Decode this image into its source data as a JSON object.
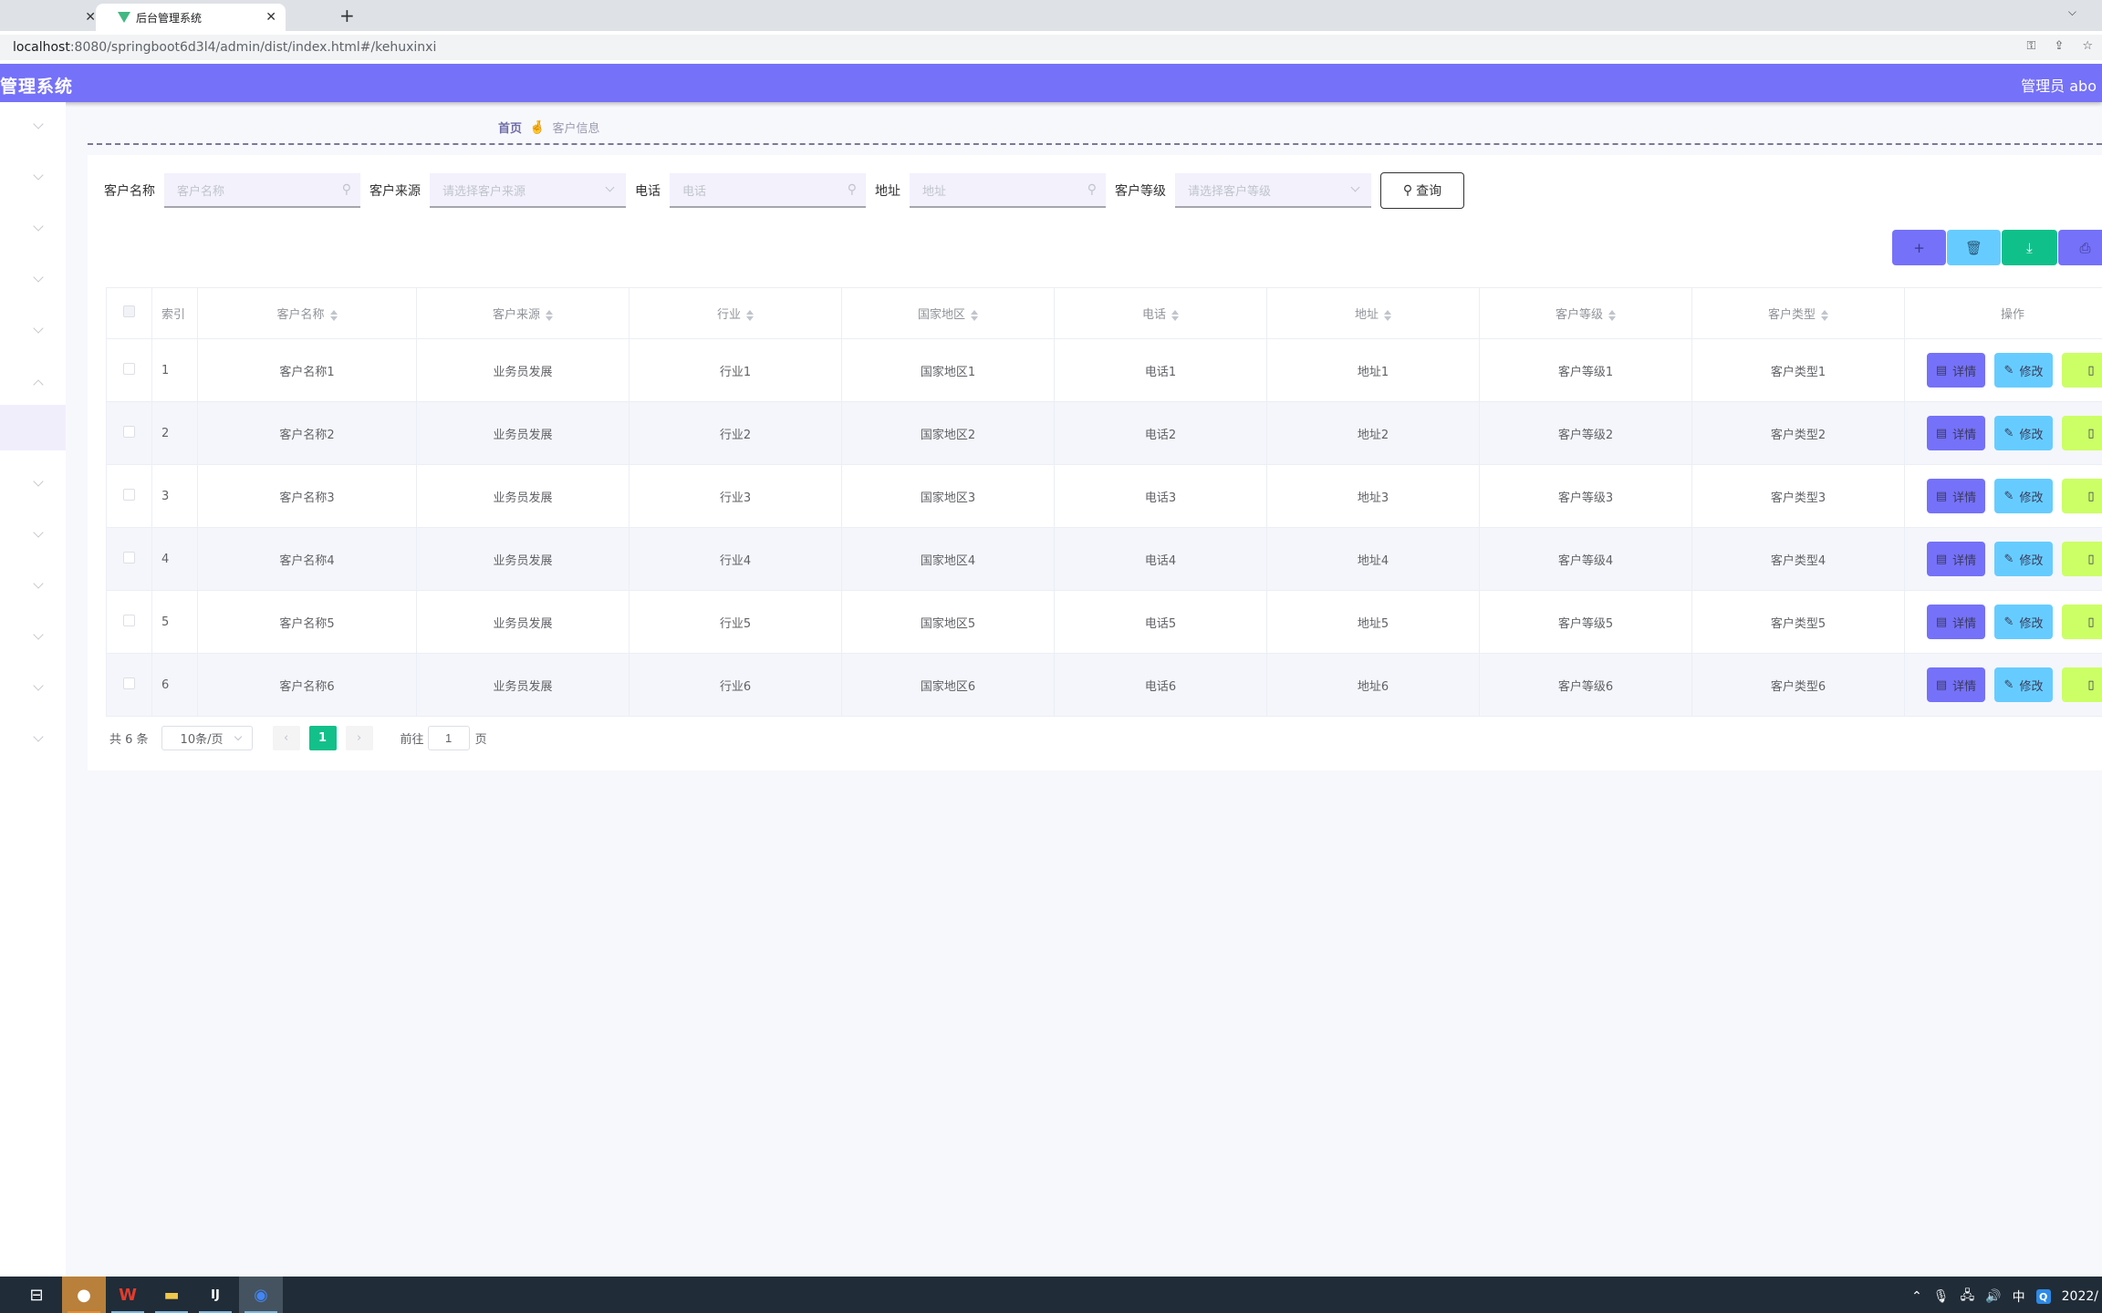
{
  "browser": {
    "tabs": [
      {
        "title": "",
        "active": false
      },
      {
        "title": "后台管理系统",
        "active": true
      }
    ],
    "new_tab_label": "+",
    "tab_close_label": "✕",
    "url_host": "localhost",
    "url_rest": ":8080/springboot6d3l4/admin/dist/index.html#/kehuxinxi"
  },
  "header": {
    "title": "管理系统",
    "user": "管理员 abo"
  },
  "sidebar": {
    "items": [
      {
        "expanded": false
      },
      {
        "expanded": false
      },
      {
        "expanded": false
      },
      {
        "expanded": false
      },
      {
        "expanded": false
      },
      {
        "expanded": true
      },
      {
        "active": true
      },
      {
        "expanded": false
      },
      {
        "expanded": false
      },
      {
        "expanded": false
      },
      {
        "expanded": false
      },
      {
        "expanded": false
      },
      {
        "expanded": false
      }
    ]
  },
  "breadcrumb": {
    "home": "首页",
    "separator": "🤞",
    "current": "客户信息"
  },
  "search": {
    "fields": [
      {
        "label": "客户名称",
        "placeholder": "客户名称",
        "type": "input",
        "icon": "search-icon"
      },
      {
        "label": "客户来源",
        "placeholder": "请选择客户来源",
        "type": "select",
        "icon": "chevron-down-icon"
      },
      {
        "label": "电话",
        "placeholder": "电话",
        "type": "input",
        "icon": "search-icon"
      },
      {
        "label": "地址",
        "placeholder": "地址",
        "type": "input",
        "icon": "search-icon"
      },
      {
        "label": "客户等级",
        "placeholder": "请选择客户等级",
        "type": "select",
        "icon": "chevron-down-icon"
      }
    ],
    "query_label": "查询"
  },
  "toolbar": {
    "add_icon": "+",
    "delete_icon": "🗑",
    "export_icon": "⤓",
    "print_icon": "⎙"
  },
  "table": {
    "columns": [
      "索引",
      "客户名称",
      "客户来源",
      "行业",
      "国家地区",
      "电话",
      "地址",
      "客户等级",
      "客户类型",
      "操作"
    ],
    "rows": [
      {
        "index": "1",
        "name": "客户名称1",
        "source": "业务员发展",
        "industry": "行业1",
        "region": "国家地区1",
        "phone": "电话1",
        "address": "地址1",
        "level": "客户等级1",
        "type": "客户类型1"
      },
      {
        "index": "2",
        "name": "客户名称2",
        "source": "业务员发展",
        "industry": "行业2",
        "region": "国家地区2",
        "phone": "电话2",
        "address": "地址2",
        "level": "客户等级2",
        "type": "客户类型2"
      },
      {
        "index": "3",
        "name": "客户名称3",
        "source": "业务员发展",
        "industry": "行业3",
        "region": "国家地区3",
        "phone": "电话3",
        "address": "地址3",
        "level": "客户等级3",
        "type": "客户类型3"
      },
      {
        "index": "4",
        "name": "客户名称4",
        "source": "业务员发展",
        "industry": "行业4",
        "region": "国家地区4",
        "phone": "电话4",
        "address": "地址4",
        "level": "客户等级4",
        "type": "客户类型4"
      },
      {
        "index": "5",
        "name": "客户名称5",
        "source": "业务员发展",
        "industry": "行业5",
        "region": "国家地区5",
        "phone": "电话5",
        "address": "地址5",
        "level": "客户等级5",
        "type": "客户类型5"
      },
      {
        "index": "6",
        "name": "客户名称6",
        "source": "业务员发展",
        "industry": "行业6",
        "region": "国家地区6",
        "phone": "电话6",
        "address": "地址6",
        "level": "客户等级6",
        "type": "客户类型6"
      }
    ],
    "actions": {
      "detail": "详情",
      "edit": "修改",
      "delete": ""
    }
  },
  "pagination": {
    "total": "共 6 条",
    "page_size": "10条/页",
    "current_page": "1",
    "goto_label": "前往",
    "goto_value": "1",
    "page_suffix": "页"
  },
  "taskbar": {
    "tray_ime": "中",
    "clock": "2022/"
  },
  "colors": {
    "primary": "#7571f9",
    "info": "#66ccff",
    "success": "#10c08a",
    "warning": "#ccff66"
  }
}
